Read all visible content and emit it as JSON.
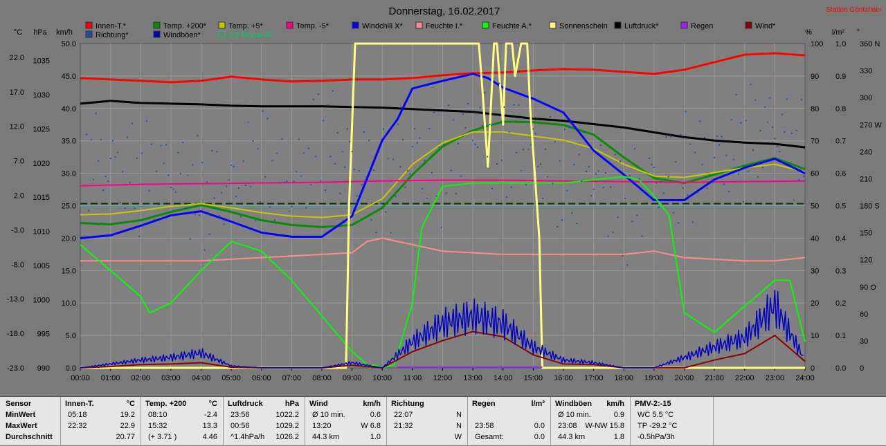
{
  "title": "Donnerstag, 16.02.2017",
  "station": "Station Göritzhain",
  "colors": {
    "background": "#7a7a7a",
    "plot_bg": "#808080",
    "grid": "#9a9a9a",
    "innen": "#ff0000",
    "temp200": "#0a8a0a",
    "temp5": "#c8c800",
    "tempm5": "#ff0080",
    "windchill": "#0000ff",
    "feuchte_i": "#ff8c8c",
    "feuchte_a": "#00ff00",
    "sonnenschein": "#ffff80",
    "luftdruck": "#000000",
    "regen": "#a020f0",
    "wind": "#8b0000",
    "richtung": "#1f4f9f",
    "windboeen": "#0000c0",
    "monat": "#00cc66"
  },
  "legend": [
    {
      "label": "Innen-T.*",
      "color": "#ff0000"
    },
    {
      "label": "Temp. +200*",
      "color": "#0a8a0a"
    },
    {
      "label": "Temp. +5*",
      "color": "#c8c800"
    },
    {
      "label": "Temp. -5*",
      "color": "#ff0080"
    },
    {
      "label": "Windchill X*",
      "color": "#0000ff"
    },
    {
      "label": "Feuchte I.*",
      "color": "#ff8c8c"
    },
    {
      "label": "Feuchte A.*",
      "color": "#00ff00"
    },
    {
      "label": "Sonnenschein",
      "color": "#ffff80"
    },
    {
      "label": "Luftdruck*",
      "color": "#000000"
    },
    {
      "label": "Regen",
      "color": "#a020f0"
    },
    {
      "label": "Wind*",
      "color": "#8b0000"
    },
    {
      "label": "Richtung*",
      "color": "#1f4f9f"
    },
    {
      "label": "Windböen*",
      "color": "#0000c0"
    },
    {
      "label": "0.8 Monat-Ø",
      "color": "#00cc66",
      "hollow": true
    }
  ],
  "axis_units": {
    "celsius": "°C",
    "hpa": "hPa",
    "kmh": "km/h",
    "percent": "%",
    "lm2": "l/m²",
    "degree": "°"
  },
  "chart_data": {
    "type": "line",
    "title": "Donnerstag, 16.02.2017",
    "x_ticks": [
      "00:00",
      "01:00",
      "02:00",
      "03:00",
      "04:00",
      "05:00",
      "06:00",
      "07:00",
      "08:00",
      "09:00",
      "10:00",
      "11:00",
      "12:00",
      "13:00",
      "14:00",
      "15:00",
      "16:00",
      "17:00",
      "18:00",
      "19:00",
      "20:00",
      "21:00",
      "22:00",
      "23:00",
      "24:00"
    ],
    "xlim": [
      0,
      24
    ],
    "axes": {
      "celsius": {
        "ticks": [
          "22.0",
          "17.0",
          "12.0",
          "7.0",
          "2.0",
          "-3.0",
          "-8.0",
          "-13.0",
          "-18.0",
          "-23.0"
        ],
        "range": [
          -23,
          24
        ]
      },
      "hpa": {
        "ticks": [
          "1035",
          "1030",
          "1025",
          "1020",
          "1015",
          "1010",
          "1005",
          "1000",
          "995",
          "990"
        ],
        "range": [
          990,
          1037.5
        ]
      },
      "kmh": {
        "ticks": [
          "50.0",
          "45.0",
          "40.0",
          "35.0",
          "30.0",
          "25.0",
          "20.0",
          "15.0",
          "10.0",
          "5.0",
          "0.0"
        ],
        "range": [
          0,
          50
        ]
      },
      "percent": {
        "ticks": [
          "100",
          "90",
          "80",
          "70",
          "60",
          "50",
          "40",
          "30",
          "20",
          "10",
          "0"
        ],
        "range": [
          0,
          100
        ]
      },
      "lm2": {
        "ticks": [
          "1.0",
          "0.9",
          "0.8",
          "0.7",
          "0.6",
          "0.5",
          "0.4",
          "0.3",
          "0.2",
          "0.1",
          "0.0"
        ],
        "range": [
          0,
          1
        ]
      },
      "degree": {
        "ticks": [
          "360 N",
          "330",
          "300",
          "270 W",
          "240",
          "210",
          "180 S",
          "150",
          "120",
          "90 O",
          "60",
          "30",
          "0"
        ],
        "range": [
          0,
          360
        ]
      }
    },
    "monat_avg_celsius": 0.8,
    "series": [
      {
        "name": "Innen-T.*",
        "axis": "celsius",
        "color": "#ff0000",
        "width": 3,
        "x": [
          0,
          1,
          2,
          3,
          4,
          5,
          6,
          7,
          8,
          9,
          10,
          11,
          12,
          13,
          14,
          15,
          16,
          17,
          18,
          19,
          20,
          21,
          22,
          23,
          24
        ],
        "y": [
          19.0,
          18.8,
          18.6,
          18.4,
          18.6,
          19.2,
          18.8,
          18.5,
          18.6,
          18.8,
          18.8,
          19.0,
          19.4,
          19.7,
          19.8,
          20.1,
          20.3,
          20.2,
          19.9,
          19.6,
          20.2,
          21.3,
          22.4,
          22.6,
          22.3
        ]
      },
      {
        "name": "Luftdruck*",
        "axis": "hpa",
        "color": "#000000",
        "width": 3,
        "x": [
          0,
          1,
          2,
          3,
          4,
          5,
          6,
          7,
          8,
          9,
          10,
          11,
          12,
          13,
          14,
          15,
          16,
          17,
          18,
          19,
          20,
          21,
          22,
          23,
          24
        ],
        "y": [
          1028.7,
          1029.1,
          1028.8,
          1028.7,
          1028.6,
          1028.4,
          1028.3,
          1028.3,
          1028.3,
          1028.2,
          1028.1,
          1027.9,
          1027.7,
          1027.5,
          1027.0,
          1026.5,
          1026.2,
          1025.7,
          1025.2,
          1024.5,
          1023.8,
          1023.3,
          1023.0,
          1022.8,
          1022.3
        ]
      },
      {
        "name": "Temp. +200*",
        "axis": "celsius",
        "color": "#0a8a0a",
        "width": 3,
        "x": [
          0,
          1,
          2,
          3,
          4,
          5,
          6,
          7,
          8,
          9,
          10,
          11,
          12,
          13,
          14,
          15,
          16,
          17,
          18,
          19,
          20,
          21,
          22,
          23,
          24
        ],
        "y": [
          -2.0,
          -2.2,
          -1.6,
          -0.4,
          0.6,
          -0.4,
          -1.6,
          -2.3,
          -2.6,
          -2.3,
          0.2,
          5.0,
          9.1,
          11.4,
          12.7,
          12.6,
          12.2,
          10.8,
          7.5,
          4.5,
          3.8,
          5.0,
          6.3,
          7.4,
          5.8
        ]
      },
      {
        "name": "Temp. +5*",
        "axis": "celsius",
        "color": "#c8c800",
        "width": 2,
        "x": [
          0,
          1,
          2,
          3,
          4,
          5,
          6,
          7,
          8,
          9,
          10,
          11,
          12,
          13,
          14,
          15,
          16,
          17,
          18,
          19,
          20,
          21,
          22,
          23,
          24
        ],
        "y": [
          -0.8,
          -0.7,
          -0.2,
          0.4,
          0.8,
          0.2,
          -0.5,
          -1.0,
          -1.2,
          -0.8,
          1.5,
          6.5,
          9.6,
          11.2,
          11.2,
          10.6,
          10.0,
          8.8,
          6.5,
          4.8,
          4.6,
          5.3,
          6.0,
          6.5,
          5.4
        ]
      },
      {
        "name": "Temp. -5*",
        "axis": "celsius",
        "color": "#ff0080",
        "width": 2,
        "x": [
          0,
          2,
          4,
          6,
          8,
          10,
          12,
          14,
          16,
          18,
          20,
          22,
          24
        ],
        "y": [
          3.4,
          3.6,
          3.7,
          3.8,
          3.9,
          4.1,
          4.2,
          4.2,
          4.1,
          4.0,
          3.9,
          4.0,
          4.1
        ]
      },
      {
        "name": "Windchill X*",
        "axis": "celsius",
        "color": "#0000ff",
        "width": 3,
        "x": [
          0,
          1,
          2,
          3,
          4,
          5,
          6,
          7,
          8,
          9,
          10,
          10.5,
          11,
          12,
          13,
          13.5,
          14,
          15,
          16,
          17,
          18,
          19,
          20,
          21,
          22,
          23,
          24
        ],
        "y": [
          -4.2,
          -3.8,
          -2.4,
          -0.9,
          -0.3,
          -1.8,
          -3.4,
          -4.0,
          -4.0,
          -1.0,
          10.0,
          13.0,
          17.5,
          18.6,
          19.6,
          19.0,
          17.6,
          16.0,
          14.0,
          8.5,
          5.0,
          1.3,
          1.3,
          4.3,
          6.0,
          7.3,
          5.2
        ]
      },
      {
        "name": "Feuchte I.*",
        "axis": "percent",
        "color": "#ff8c8c",
        "width": 2,
        "x": [
          0,
          2,
          4,
          6,
          7,
          8,
          9,
          9.5,
          10,
          11,
          12,
          14,
          16,
          18,
          19,
          20,
          22,
          23,
          24
        ],
        "y": [
          33,
          33,
          33,
          34,
          34.5,
          35,
          35.5,
          39,
          40,
          38,
          36,
          35,
          35,
          35,
          36,
          34,
          33,
          33,
          34
        ]
      },
      {
        "name": "Feuchte A.*",
        "axis": "percent",
        "color": "#00ff00",
        "width": 2,
        "x": [
          0,
          1,
          2,
          2.3,
          3,
          4,
          5,
          6,
          7,
          8,
          9,
          9.5,
          9.6,
          9.7,
          10,
          10.4,
          11,
          11.3,
          12,
          13,
          14,
          15,
          16,
          17,
          18,
          18.5,
          19,
          19.5,
          20,
          21,
          22,
          23,
          23.5,
          24
        ],
        "y": [
          38,
          30,
          22,
          17,
          20,
          30,
          39,
          36,
          27,
          16,
          5,
          1,
          0,
          1,
          0,
          1,
          20,
          43,
          56,
          57,
          57,
          57,
          57,
          58,
          59,
          58,
          53,
          47,
          17,
          11,
          19,
          27,
          27,
          8
        ]
      },
      {
        "name": "Sonnenschein",
        "axis": "percent",
        "color": "#ffff80",
        "width": 3,
        "step": true,
        "x": [
          0,
          8.8,
          8.9,
          9.1,
          13.2,
          13.3,
          13.5,
          13.7,
          13.8,
          14.0,
          14.1,
          14.3,
          14.4,
          14.6,
          14.8,
          14.9,
          15.2,
          15.3,
          24
        ],
        "y": [
          0,
          0,
          50,
          100,
          100,
          88,
          62,
          100,
          100,
          75,
          100,
          100,
          90,
          100,
          100,
          80,
          40,
          0,
          0
        ]
      },
      {
        "name": "Wind*",
        "axis": "kmh",
        "color": "#8b0000",
        "width": 2,
        "x": [
          0,
          1,
          2,
          3,
          4,
          5,
          6,
          7,
          8,
          9,
          10,
          11,
          12,
          13,
          14,
          15,
          16,
          17,
          18,
          19,
          20,
          21,
          22,
          23,
          24
        ],
        "y": [
          0,
          0.2,
          0.5,
          0.6,
          0.8,
          0.1,
          0,
          0,
          0,
          0.4,
          0,
          2.5,
          4.2,
          5.6,
          4.8,
          2.0,
          0.6,
          0.5,
          0,
          0,
          0,
          1.2,
          2.2,
          5.0,
          1.0
        ]
      },
      {
        "name": "Windböen*",
        "axis": "kmh",
        "color": "#0000c0",
        "width": 1.5,
        "jitter": true,
        "x": [
          0,
          1,
          2,
          3,
          4,
          5,
          6,
          7,
          8,
          9,
          10,
          11,
          12,
          13,
          14,
          15,
          16,
          17,
          18,
          19,
          20,
          21,
          22,
          23,
          24
        ],
        "y": [
          0,
          0.6,
          1.2,
          1.6,
          2.3,
          0.3,
          0,
          0,
          0,
          0.8,
          0,
          4.0,
          6.8,
          8.0,
          6.8,
          3.2,
          1.2,
          0.8,
          0,
          0,
          1.6,
          3.2,
          4.6,
          9.6,
          1.2
        ]
      },
      {
        "name": "Richtung*",
        "axis": "degree",
        "color": "#1f4f9f",
        "scatter": true,
        "x": [
          0,
          2,
          3,
          4,
          5,
          6,
          7,
          8,
          9,
          10,
          11,
          12,
          13,
          14,
          15,
          16,
          17,
          18,
          19,
          20,
          21,
          22,
          23,
          24
        ],
        "y": [
          240,
          210,
          220,
          190,
          200,
          230,
          200,
          260,
          230,
          200,
          240,
          220,
          270,
          250,
          240,
          210,
          220,
          170,
          210,
          220,
          230,
          250,
          270,
          230
        ]
      }
    ]
  },
  "table": {
    "row_labels": [
      "Sensor",
      "MinWert",
      "MaxWert",
      "Durchschnitt"
    ],
    "columns": [
      {
        "h": [
          "Innen-T.",
          "°C"
        ],
        "rows": [
          [
            "05:18",
            "19.2"
          ],
          [
            "22:32",
            "22.9"
          ],
          [
            "",
            "20.77"
          ]
        ]
      },
      {
        "h": [
          "Temp. +200",
          "°C"
        ],
        "rows": [
          [
            "08:10",
            "-2.4"
          ],
          [
            "15:32",
            "13.3"
          ],
          [
            "(+ 3.71 )",
            "4.46"
          ]
        ]
      },
      {
        "h": [
          "Luftdruck",
          "hPa"
        ],
        "rows": [
          [
            "23:56",
            "1022.2"
          ],
          [
            "00:56",
            "1029.2"
          ],
          [
            "^1.4hPa/h",
            "1026.2"
          ]
        ]
      },
      {
        "h": [
          "Wind",
          "km/h"
        ],
        "rows": [
          [
            "Ø 10 min.",
            "0.6"
          ],
          [
            "13:20",
            "W 6.8"
          ],
          [
            "44.3 km",
            "1.0"
          ]
        ]
      },
      {
        "h": [
          "Richtung",
          ""
        ],
        "rows": [
          [
            "22:07",
            "N"
          ],
          [
            "21:32",
            "N"
          ],
          [
            "",
            "W"
          ]
        ]
      },
      {
        "h": [
          "Regen",
          "l/m²"
        ],
        "rows": [
          [
            "",
            ""
          ],
          [
            "23:58",
            "0.0"
          ],
          [
            "Gesamt:",
            "0.0"
          ]
        ]
      },
      {
        "h": [
          "Windböen",
          "km/h"
        ],
        "rows": [
          [
            "Ø 10 min.",
            "0.9"
          ],
          [
            "23:08",
            "W-NW 15.8"
          ],
          [
            "44.3 km",
            "1.8"
          ]
        ]
      },
      {
        "h": [
          "PMV-2:-15",
          ""
        ],
        "rows": [
          [
            "WC 5.5 °C",
            ""
          ],
          [
            "TP -29.2 °C",
            ""
          ],
          [
            "-0.5hPa/3h",
            ""
          ]
        ]
      }
    ]
  }
}
